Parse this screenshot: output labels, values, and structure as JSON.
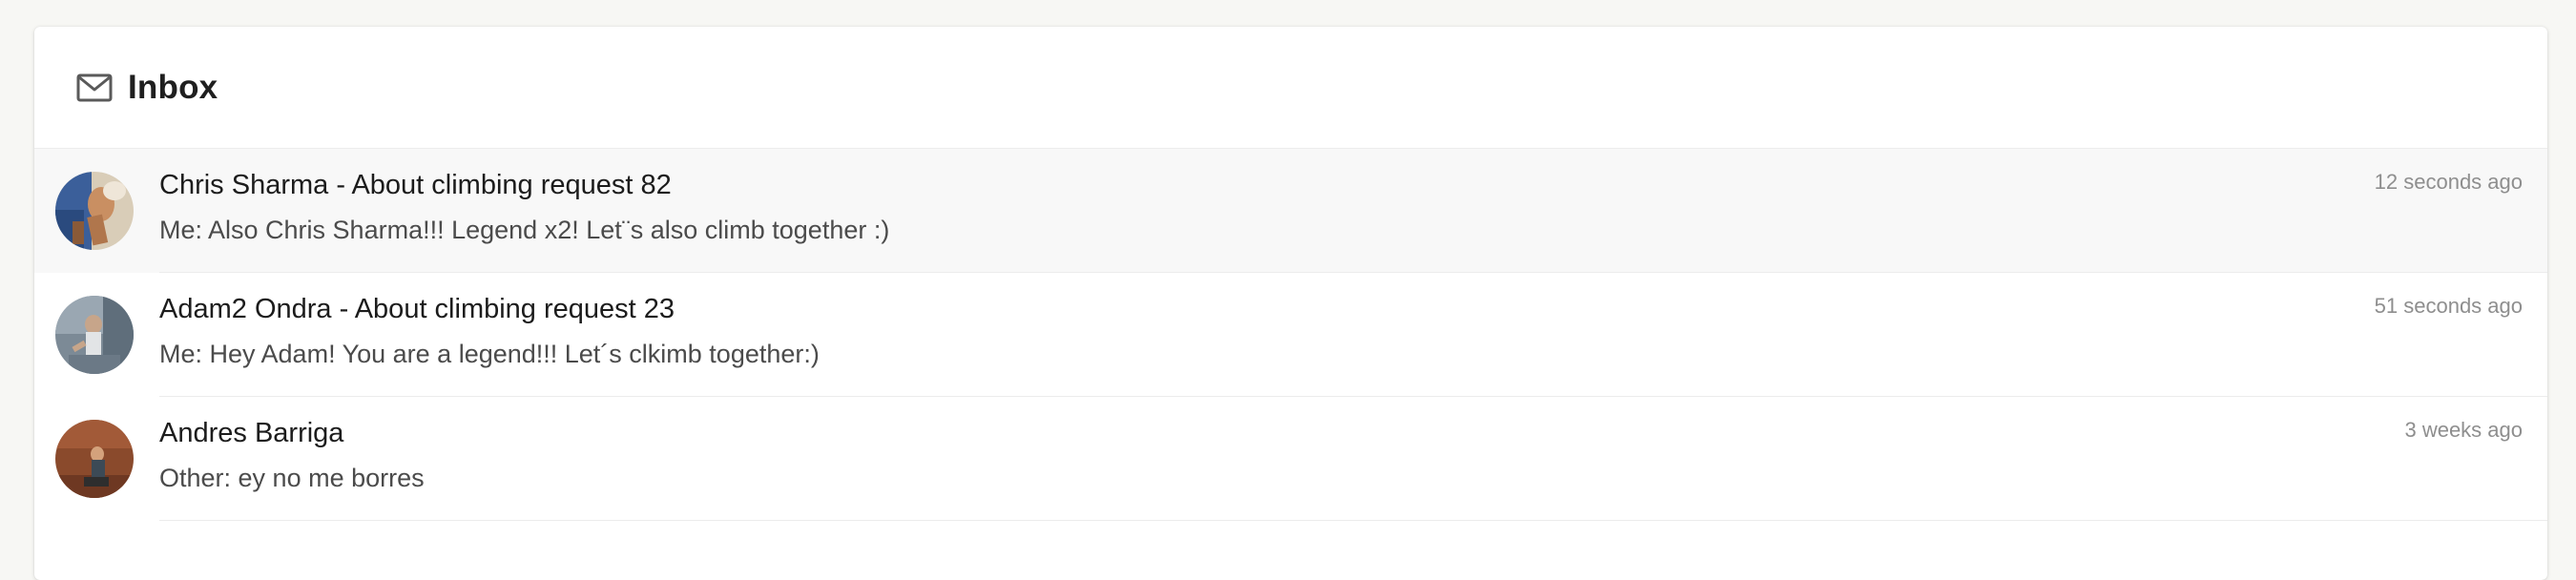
{
  "inbox": {
    "title": "Inbox",
    "icon": "mail-icon"
  },
  "conversations": [
    {
      "title": "Chris Sharma - About climbing request 82",
      "preview": "Me: Also Chris Sharma!!! Legend x2! Let¨s also climb together :)",
      "time": "12 seconds ago",
      "active": true
    },
    {
      "title": "Adam2 Ondra - About climbing request 23",
      "preview": "Me: Hey Adam! You are a legend!!! Let´s clkimb together:)",
      "time": "51 seconds ago",
      "active": false
    },
    {
      "title": "Andres Barriga",
      "preview": "Other: ey no me borres",
      "time": "3 weeks ago",
      "active": false
    }
  ],
  "colors": {
    "active_row": "#f8f8f8",
    "title_text": "#1c1c1c",
    "preview_text": "#4b4b4b",
    "time_text": "#8e8e8e"
  }
}
